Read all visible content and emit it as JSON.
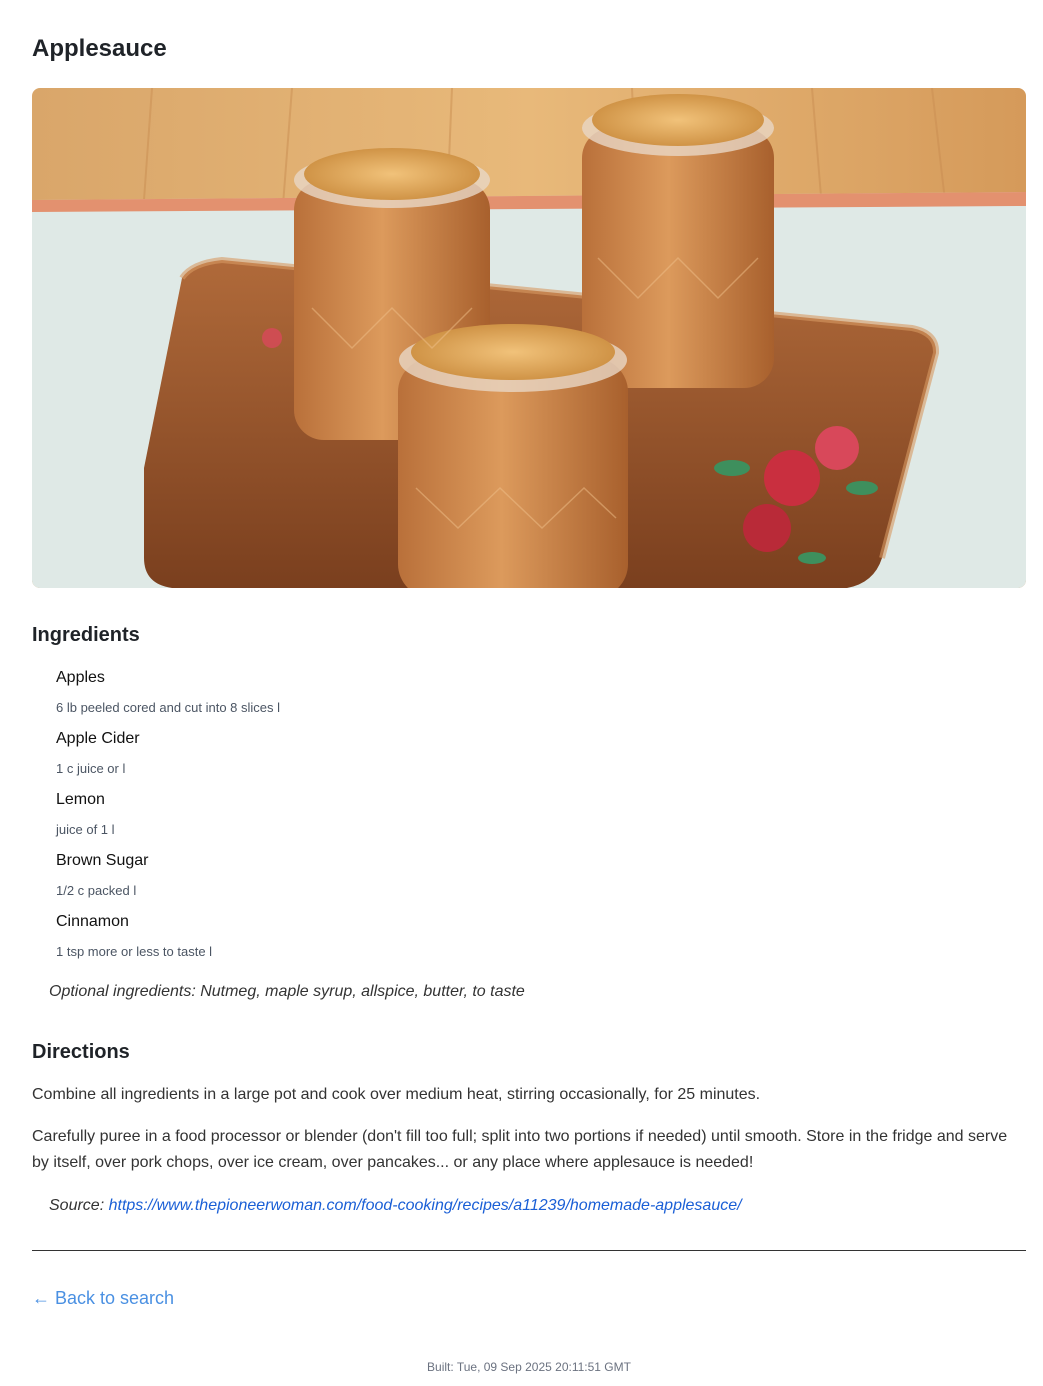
{
  "recipe": {
    "title": "Applesauce",
    "image_alt": "Applesauce",
    "ingredients_heading": "Ingredients",
    "ingredients": [
      {
        "name": "Apples",
        "quantity": "6 lb peeled cored and cut into 8 slices l"
      },
      {
        "name": "Apple Cider",
        "quantity": "1 c juice or l"
      },
      {
        "name": "Lemon",
        "quantity": "juice of 1 l"
      },
      {
        "name": "Brown Sugar",
        "quantity": "1/2 c packed l"
      },
      {
        "name": "Cinnamon",
        "quantity": "1 tsp more or less to taste l"
      }
    ],
    "optional_ingredients": "Optional ingredients: Nutmeg, maple syrup, allspice, butter, to taste",
    "directions_heading": "Directions",
    "directions": [
      "Combine all ingredients in a large pot and cook over medium heat, stirring occasionally, for 25 minutes.",
      "Carefully puree in a food processor or blender (don't fill too full; split into two portions if needed) until smooth. Store in the fridge and serve by itself, over pork chops, over ice cream, over pancakes... or any place where applesauce is needed!"
    ],
    "source_label": "Source:",
    "source_url": "https://www.thepioneerwoman.com/food-cooking/recipes/a11239/homemade-applesauce/"
  },
  "nav": {
    "back_label": "← Back to search"
  },
  "footer": {
    "built": "Built: Tue, 09 Sep 2025 20:11:51 GMT"
  },
  "colors": {
    "link": "#1a5fd6",
    "back_link": "#4a90e2",
    "text": "#333333"
  }
}
